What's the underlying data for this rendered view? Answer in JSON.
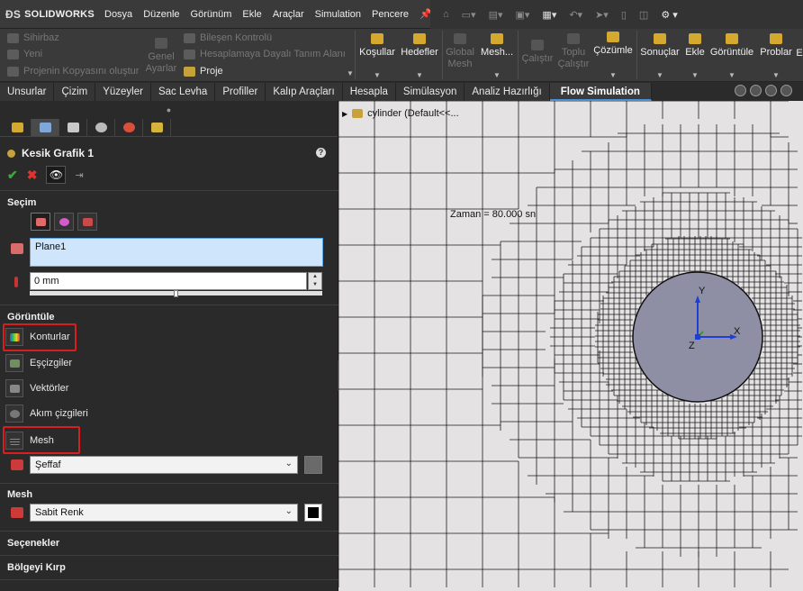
{
  "app": {
    "name": "SOLIDWORKS"
  },
  "menu": [
    "Dosya",
    "Düzenle",
    "Görünüm",
    "Ekle",
    "Araçlar",
    "Simulation",
    "Pencere"
  ],
  "ribbon": {
    "left_items": [
      "Sihirbaz",
      "Yeni",
      "Projenin Kopyasını oluştur"
    ],
    "general": "Genel Ayarlar",
    "mid_items": [
      "Bileşen Kontrolü",
      "Hesaplamaya Dayalı Tanım Alanı",
      "Proje"
    ],
    "buttons": [
      {
        "label": "Koşullar",
        "enabled": true
      },
      {
        "label": "Hedefler",
        "enabled": true
      },
      {
        "label": "Global Mesh",
        "enabled": false
      },
      {
        "label": "Mesh...",
        "enabled": true
      },
      {
        "label": "Çalıştır",
        "enabled": false
      },
      {
        "label": "Toplu Çalıştır",
        "enabled": false
      },
      {
        "label": "Çözümle",
        "enabled": true
      },
      {
        "label": "Sonuçlar",
        "enabled": true
      },
      {
        "label": "Ekle",
        "enabled": true
      },
      {
        "label": "Görüntüle",
        "enabled": true
      },
      {
        "label": "Problar",
        "enabled": true
      }
    ]
  },
  "command_tabs": [
    "Unsurlar",
    "Çizim",
    "Yüzeyler",
    "Sac Levha",
    "Profiller",
    "Kalıp Araçları",
    "Hesapla",
    "Simülasyon",
    "Analiz Hazırlığı",
    "Flow Simulation"
  ],
  "active_tab": "Flow Simulation",
  "property_manager": {
    "title": "Kesik Grafik 1",
    "help": "?",
    "selection": {
      "heading": "Seçim",
      "plane": "Plane1",
      "offset": "0 mm"
    },
    "display": {
      "heading": "Görüntüle",
      "items": [
        "Konturlar",
        "Eşçizgiler",
        "Vektörler",
        "Akım çizgileri",
        "Mesh"
      ],
      "highlighted": [
        "Konturlar",
        "Mesh"
      ],
      "transparency": "Şeffaf"
    },
    "mesh": {
      "heading": "Mesh",
      "color_mode": "Sabit Renk",
      "color": "#000000"
    },
    "options_heading": "Seçenekler",
    "crop_heading": "Bölgeyi Kırp"
  },
  "viewport": {
    "tree_item": "cylinder  (Default<<...",
    "time": "Zaman = 80.000 sn",
    "axis_x": "X",
    "axis_y": "Y",
    "axis_z": "Z",
    "colors": {
      "background": "#e4e2e3",
      "cylinder": "#8e8ea4",
      "mesh": "#1a1a1a"
    }
  }
}
